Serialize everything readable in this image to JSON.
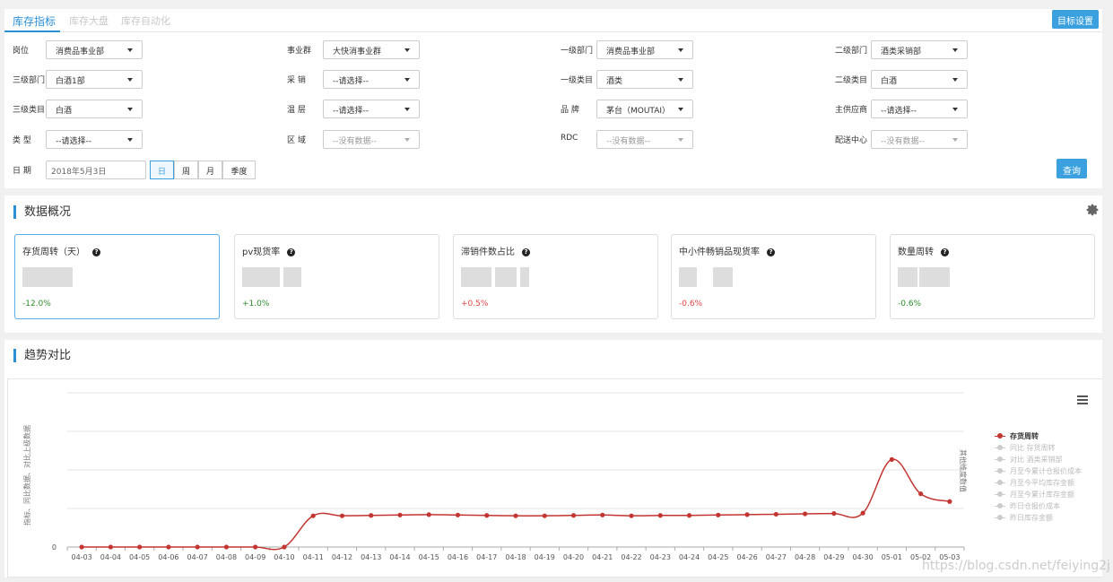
{
  "tabs": [
    {
      "label": "库存指标",
      "active": true
    },
    {
      "label": "库存大盘",
      "active": false
    },
    {
      "label": "库存自动化",
      "active": false
    }
  ],
  "target_button": "目标设置",
  "filters": [
    {
      "label": "岗位",
      "value": "消费品事业部",
      "disabled": false
    },
    {
      "label": "事业群",
      "value": "大快消事业群",
      "disabled": false
    },
    {
      "label": "一级部门",
      "value": "消费品事业部",
      "disabled": false
    },
    {
      "label": "二级部门",
      "value": "酒类采销部",
      "disabled": false
    },
    {
      "label": "三级部门",
      "value": "白酒1部",
      "disabled": false
    },
    {
      "label": "采 销",
      "value": "--请选择--",
      "disabled": false
    },
    {
      "label": "一级类目",
      "value": "酒类",
      "disabled": false
    },
    {
      "label": "二级类目",
      "value": "白酒",
      "disabled": false
    },
    {
      "label": "三级类目",
      "value": "白酒",
      "disabled": false
    },
    {
      "label": "温 层",
      "value": "--请选择--",
      "disabled": false
    },
    {
      "label": "品 牌",
      "value": "茅台（MOUTAI）",
      "disabled": false
    },
    {
      "label": "主供应商",
      "value": "--请选择--",
      "disabled": false
    },
    {
      "label": "类 型",
      "value": "--请选择--",
      "disabled": false
    },
    {
      "label": "区 域",
      "value": "--没有数据--",
      "disabled": true
    },
    {
      "label": "RDC",
      "value": "--没有数据--",
      "disabled": true
    },
    {
      "label": "配送中心",
      "value": "--没有数据--",
      "disabled": true
    }
  ],
  "date": {
    "label": "日 期",
    "value": "2018年5月3日",
    "periods": [
      "日",
      "周",
      "月",
      "季度"
    ],
    "active_period": "日"
  },
  "query_button": "查询",
  "overview": {
    "title": "数据概况",
    "cards": [
      {
        "title": "存货周转（天）",
        "delta": "-12.0%",
        "trend": "neg"
      },
      {
        "title": "pv现货率",
        "delta": "+1.0%",
        "trend": "neg"
      },
      {
        "title": "滞销件数占比",
        "delta": "+0.5%",
        "trend": "pos"
      },
      {
        "title": "中小件畅销品现货率",
        "delta": "-0.6%",
        "trend": "pos"
      },
      {
        "title": "数量周转",
        "delta": "-0.6%",
        "trend": "neg"
      }
    ]
  },
  "trend": {
    "title": "趋势对比",
    "ylabel_left": "指标、同比数据、对比上级数据",
    "ylabel_right": "其他维度数值",
    "legend": [
      {
        "label": "存货周转",
        "on": true
      },
      {
        "label": "同比 存货周转",
        "on": false
      },
      {
        "label": "对比 酒类采销部",
        "on": false
      },
      {
        "label": "月至今累计仓报价成本",
        "on": false
      },
      {
        "label": "月至今平均库存金额",
        "on": false
      },
      {
        "label": "月至今累计库存金额",
        "on": false
      },
      {
        "label": "昨日仓报价成本",
        "on": false
      },
      {
        "label": "昨日库存金额",
        "on": false
      }
    ]
  },
  "chart_data": {
    "type": "line",
    "x": [
      "04-03",
      "04-04",
      "04-05",
      "04-06",
      "04-07",
      "04-08",
      "04-09",
      "04-10",
      "04-11",
      "04-12",
      "04-13",
      "04-14",
      "04-15",
      "04-16",
      "04-17",
      "04-18",
      "04-19",
      "04-20",
      "04-21",
      "04-22",
      "04-23",
      "04-24",
      "04-25",
      "04-26",
      "04-27",
      "04-28",
      "04-29",
      "04-30",
      "05-01",
      "05-02",
      "05-03"
    ],
    "series": [
      {
        "name": "存货周转",
        "color": "#c23531",
        "values": [
          0,
          0,
          0,
          0,
          0,
          0,
          0,
          0,
          0.81,
          0.81,
          0.82,
          0.83,
          0.84,
          0.83,
          0.82,
          0.81,
          0.81,
          0.82,
          0.83,
          0.81,
          0.82,
          0.82,
          0.83,
          0.84,
          0.85,
          0.86,
          0.87,
          0.88,
          2.27,
          1.38,
          1.18
        ]
      }
    ],
    "yticks": [
      "0"
    ],
    "ymax": 4,
    "grid": true,
    "legend_position": "right"
  },
  "watermark": "https://blog.csdn.net/feiying2j"
}
